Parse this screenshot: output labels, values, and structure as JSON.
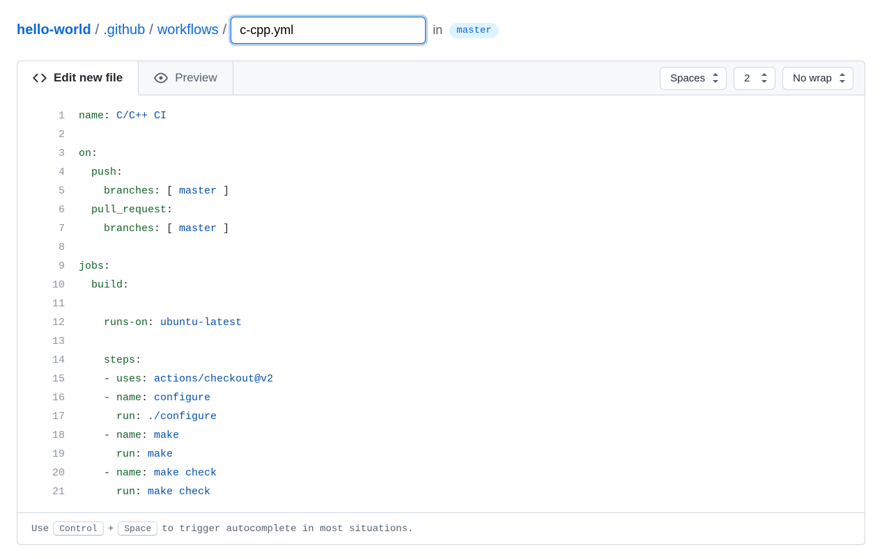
{
  "breadcrumb": {
    "repo": "hello-world",
    "segments": [
      ".github",
      "workflows"
    ],
    "filename": "c-cpp.yml",
    "in_label": "in",
    "branch": "master"
  },
  "tabs": {
    "edit_label": "Edit new file",
    "preview_label": "Preview"
  },
  "toolbar": {
    "indent_mode": "Spaces",
    "indent_size": "2",
    "wrap_mode": "No wrap"
  },
  "code": {
    "lines": [
      [
        {
          "t": "name",
          "c": "k"
        },
        {
          "t": ": ",
          "c": "s"
        },
        {
          "t": "C/C++ CI",
          "c": "b"
        }
      ],
      [],
      [
        {
          "t": "on",
          "c": "k"
        },
        {
          "t": ":",
          "c": "s"
        }
      ],
      [
        {
          "t": "  ",
          "c": "s"
        },
        {
          "t": "push",
          "c": "k"
        },
        {
          "t": ":",
          "c": "s"
        }
      ],
      [
        {
          "t": "    ",
          "c": "s"
        },
        {
          "t": "branches",
          "c": "k"
        },
        {
          "t": ": [ ",
          "c": "s"
        },
        {
          "t": "master",
          "c": "b"
        },
        {
          "t": " ]",
          "c": "s"
        }
      ],
      [
        {
          "t": "  ",
          "c": "s"
        },
        {
          "t": "pull_request",
          "c": "k"
        },
        {
          "t": ":",
          "c": "s"
        }
      ],
      [
        {
          "t": "    ",
          "c": "s"
        },
        {
          "t": "branches",
          "c": "k"
        },
        {
          "t": ": [ ",
          "c": "s"
        },
        {
          "t": "master",
          "c": "b"
        },
        {
          "t": " ]",
          "c": "s"
        }
      ],
      [],
      [
        {
          "t": "jobs",
          "c": "k"
        },
        {
          "t": ":",
          "c": "s"
        }
      ],
      [
        {
          "t": "  ",
          "c": "s"
        },
        {
          "t": "build",
          "c": "k"
        },
        {
          "t": ":",
          "c": "s"
        }
      ],
      [],
      [
        {
          "t": "    ",
          "c": "s"
        },
        {
          "t": "runs-on",
          "c": "k"
        },
        {
          "t": ": ",
          "c": "s"
        },
        {
          "t": "ubuntu-latest",
          "c": "b"
        }
      ],
      [],
      [
        {
          "t": "    ",
          "c": "s"
        },
        {
          "t": "steps",
          "c": "k"
        },
        {
          "t": ":",
          "c": "s"
        }
      ],
      [
        {
          "t": "    - ",
          "c": "s"
        },
        {
          "t": "uses",
          "c": "k"
        },
        {
          "t": ": ",
          "c": "s"
        },
        {
          "t": "actions/checkout@v2",
          "c": "b"
        }
      ],
      [
        {
          "t": "    - ",
          "c": "s"
        },
        {
          "t": "name",
          "c": "k"
        },
        {
          "t": ": ",
          "c": "s"
        },
        {
          "t": "configure",
          "c": "b"
        }
      ],
      [
        {
          "t": "      ",
          "c": "s"
        },
        {
          "t": "run",
          "c": "k"
        },
        {
          "t": ": ",
          "c": "s"
        },
        {
          "t": "./configure",
          "c": "b"
        }
      ],
      [
        {
          "t": "    - ",
          "c": "s"
        },
        {
          "t": "name",
          "c": "k"
        },
        {
          "t": ": ",
          "c": "s"
        },
        {
          "t": "make",
          "c": "b"
        }
      ],
      [
        {
          "t": "      ",
          "c": "s"
        },
        {
          "t": "run",
          "c": "k"
        },
        {
          "t": ": ",
          "c": "s"
        },
        {
          "t": "make",
          "c": "b"
        }
      ],
      [
        {
          "t": "    - ",
          "c": "s"
        },
        {
          "t": "name",
          "c": "k"
        },
        {
          "t": ": ",
          "c": "s"
        },
        {
          "t": "make check",
          "c": "b"
        }
      ],
      [
        {
          "t": "      ",
          "c": "s"
        },
        {
          "t": "run",
          "c": "k"
        },
        {
          "t": ": ",
          "c": "s"
        },
        {
          "t": "make check",
          "c": "b"
        }
      ]
    ]
  },
  "footer": {
    "pre": "Use",
    "kbd1": "Control",
    "plus": "+",
    "kbd2": "Space",
    "post": "to trigger autocomplete in most situations."
  }
}
